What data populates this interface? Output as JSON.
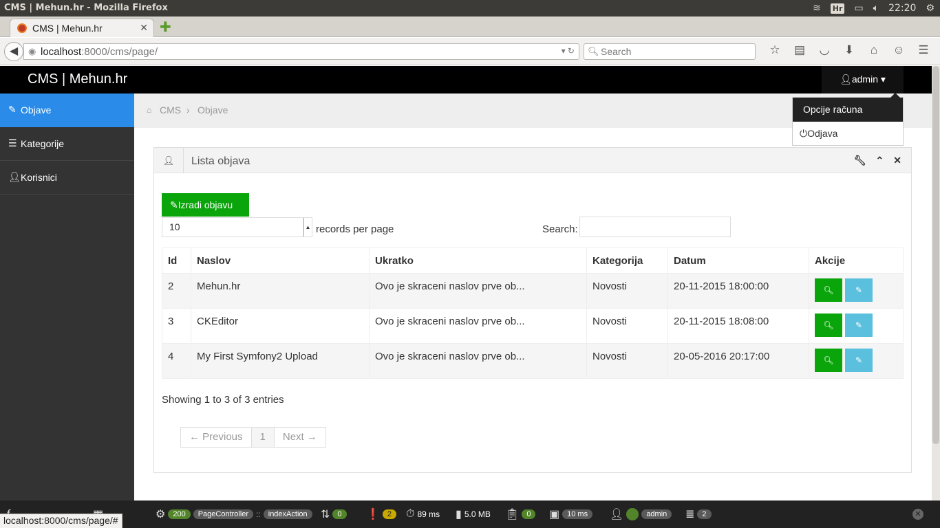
{
  "os": {
    "window_title": "CMS | Mehun.hr - Mozilla Firefox",
    "keyboard_layout": "Hr",
    "clock": "22:20"
  },
  "browser": {
    "tab_title": "CMS | Mehun.hr",
    "url_host": "localhost",
    "url_rest": ":8000/cms/page/",
    "search_placeholder": "Search",
    "status_url": "localhost:8000/cms/page/#"
  },
  "app": {
    "brand": "CMS | Mehun.hr",
    "user": "admin",
    "user_menu": {
      "header": "Opcije računa",
      "logout": "Odjava"
    },
    "sidebar": [
      {
        "label": "Objave",
        "icon": "edit-icon",
        "active": true
      },
      {
        "label": "Kategorije",
        "icon": "list-icon",
        "active": false
      },
      {
        "label": "Korisnici",
        "icon": "user-icon",
        "active": false
      }
    ],
    "breadcrumb": [
      "CMS",
      "Objave"
    ],
    "breadcrumb_sep": "›"
  },
  "panel": {
    "title": "Lista objava",
    "create_button": "Izradi objavu",
    "page_length": "10",
    "page_length_label": "records per page",
    "search_label": "Search:",
    "columns": [
      "Id",
      "Naslov",
      "Ukratko",
      "Kategorija",
      "Datum",
      "Akcije"
    ],
    "rows": [
      {
        "id": "2",
        "naslov": "Mehun.hr",
        "ukratko": "Ovo je skraceni naslov prve ob...",
        "kategorija": "Novosti",
        "datum": "20-11-2015 18:00:00"
      },
      {
        "id": "3",
        "naslov": "CKEditor",
        "ukratko": "Ovo je skraceni naslov prve ob...",
        "kategorija": "Novosti",
        "datum": "20-11-2015 18:08:00"
      },
      {
        "id": "4",
        "naslov": "My First Symfony2 Upload",
        "ukratko": "Ovo je skraceni naslov prve ob...",
        "kategorija": "Novosti",
        "datum": "20-05-2016 20:17:00"
      }
    ],
    "info": "Showing 1 to 3 of 3 entries",
    "pager": {
      "previous": "← Previous",
      "current": "1",
      "next": "Next →"
    }
  },
  "profiler": {
    "status_code": "200",
    "controller": "PageController",
    "action": "indexAction",
    "ajax_count": "0",
    "warnings": "2",
    "time": "89 ms",
    "memory": "5.0 MB",
    "forms": "0",
    "twig_time": "10 ms",
    "user": "admin",
    "db_queries": "2"
  },
  "colors": {
    "primary_blue": "#2a8ce8",
    "success_green": "#0aa50a",
    "info_cyan": "#5bc0de"
  }
}
